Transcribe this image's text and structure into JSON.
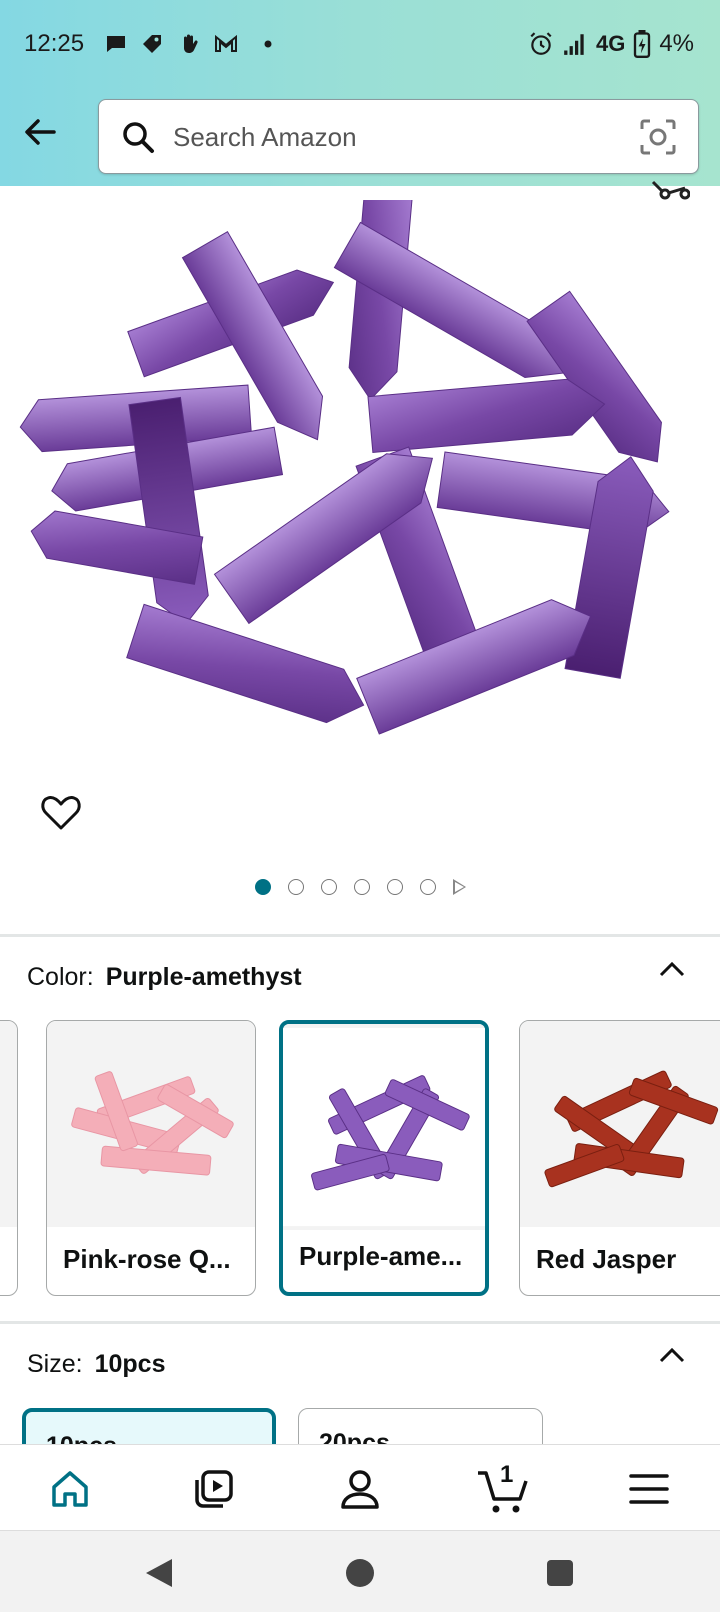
{
  "status_bar": {
    "time": "12:25",
    "network": "4G",
    "battery": "4%"
  },
  "search": {
    "placeholder": "Search Amazon"
  },
  "image_carousel": {
    "count": 6,
    "active_index": 0
  },
  "color": {
    "label": "Color:",
    "value": "Purple-amethyst",
    "options": [
      {
        "label": "Pink-rose Q...",
        "color": "#f4aeb8"
      },
      {
        "label": "Purple-ame...",
        "color": "#7b4aa8"
      },
      {
        "label": "Red Jasper",
        "color": "#a8321f"
      }
    ]
  },
  "size": {
    "label": "Size:",
    "value": "10pcs",
    "options": [
      "10pcs",
      "20pcs"
    ]
  },
  "cart": {
    "count": "1"
  },
  "colors": {
    "accent": "#007185"
  }
}
